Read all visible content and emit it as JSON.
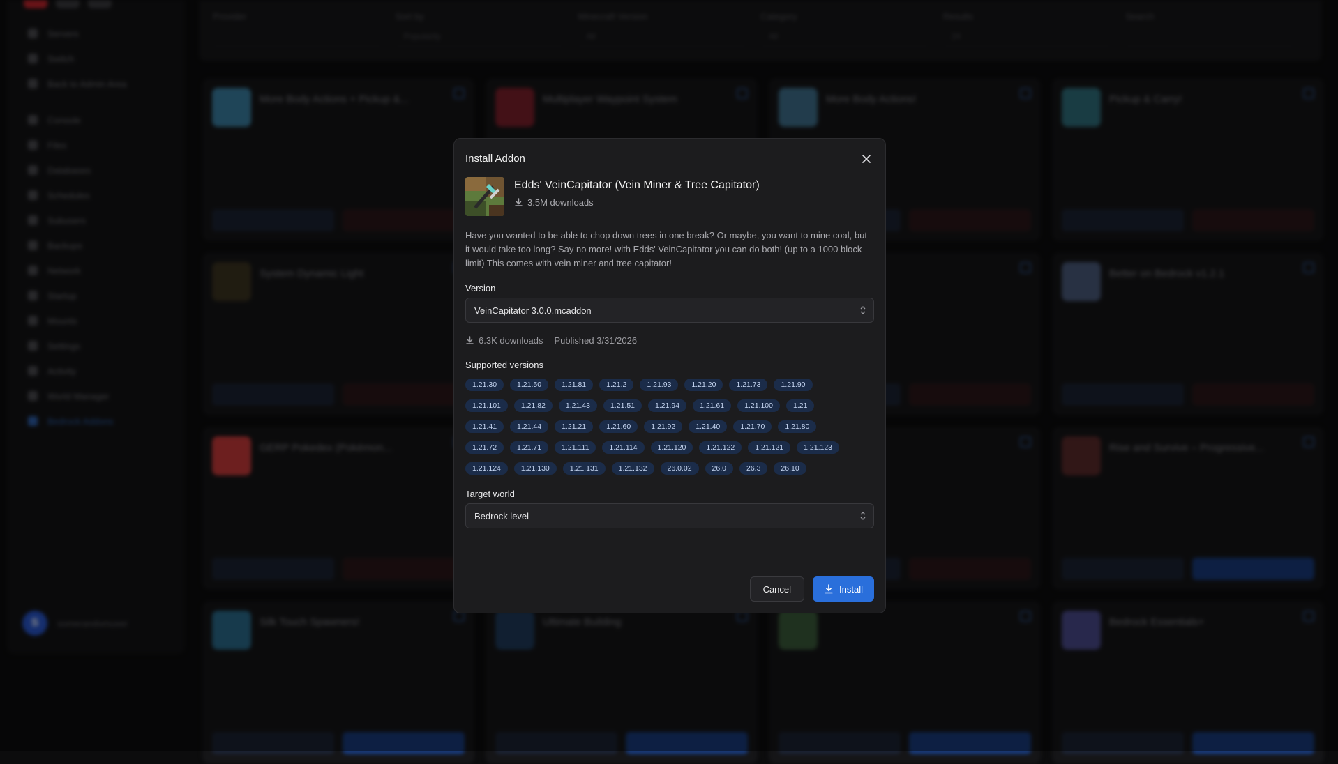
{
  "sidebar": {
    "items_a": [
      "Servers",
      "Switch",
      "Back to Admin Area"
    ],
    "items_b": [
      "Console",
      "Files",
      "Databases",
      "Schedules",
      "Subusers",
      "Backups",
      "Network",
      "Startup",
      "Mounts",
      "Settings",
      "Activity",
      "World Manager",
      "Bedrock Addons"
    ],
    "active_item": "Bedrock Addons",
    "username": "somerandomuser"
  },
  "filters": {
    "labels": [
      "Provider",
      "Sort by",
      "Minecraft Version",
      "Category",
      "Results",
      "Search"
    ],
    "values": [
      "",
      "Popularity",
      "All",
      "All",
      "24",
      ""
    ]
  },
  "cards": [
    {
      "title": "More Body Actions + Pickup &...",
      "install": false
    },
    {
      "title": "Multiplayer Waypoint System",
      "install": false
    },
    {
      "title": "More Body Actions!",
      "install": false
    },
    {
      "title": "Pickup & Carry!",
      "install": false
    },
    {
      "title": "System Dynamic Light",
      "install": false
    },
    {
      "title": "",
      "install": false
    },
    {
      "title": "",
      "install": false
    },
    {
      "title": "Better on Bedrock v1.2.1",
      "install": false
    },
    {
      "title": "GERP Pokedex (Pokémon...",
      "install": false
    },
    {
      "title": "",
      "install": false
    },
    {
      "title": "",
      "install": false
    },
    {
      "title": "Rise and Survive – Progressive...",
      "install": true
    },
    {
      "title": "Silk Touch Spawners!",
      "install": true
    },
    {
      "title": "Ultimate Building",
      "install": true
    },
    {
      "title": "",
      "install": true
    },
    {
      "title": "Bedrock Essentials+",
      "install": true
    }
  ],
  "modal": {
    "title": "Install Addon",
    "addon_name": "Edds' VeinCapitator (Vein Miner & Tree Capitator)",
    "addon_downloads": "3.5M downloads",
    "description": "Have you wanted to be able to chop down trees in one break? Or maybe, you want to mine coal, but it would take too long? Say no more! with Edds' VeinCapitator you can do both! (up to a 1000 block limit) This comes with vein miner and tree capitator!",
    "version_label": "Version",
    "version_value": "VeinCapitator 3.0.0.mcaddon",
    "version_downloads": "6.3K downloads",
    "version_published": "Published 3/31/2026",
    "supported_label": "Supported versions",
    "supported_versions": [
      "1.21.30",
      "1.21.50",
      "1.21.81",
      "1.21.2",
      "1.21.93",
      "1.21.20",
      "1.21.73",
      "1.21.90",
      "1.21.101",
      "1.21.82",
      "1.21.43",
      "1.21.51",
      "1.21.94",
      "1.21.61",
      "1.21.100",
      "1.21",
      "1.21.41",
      "1.21.44",
      "1.21.21",
      "1.21.60",
      "1.21.92",
      "1.21.40",
      "1.21.70",
      "1.21.80",
      "1.21.72",
      "1.21.71",
      "1.21.111",
      "1.21.114",
      "1.21.120",
      "1.21.122",
      "1.21.121",
      "1.21.123",
      "1.21.124",
      "1.21.130",
      "1.21.131",
      "1.21.132",
      "26.0.02",
      "26.0",
      "26.3",
      "26.10"
    ],
    "target_label": "Target world",
    "target_value": "Bedrock level",
    "cancel_label": "Cancel",
    "install_label": "Install"
  },
  "colors": {
    "accent": "#2a6fdb",
    "chip_bg": "#1b2c49",
    "modal_bg": "#1c1c1e"
  }
}
